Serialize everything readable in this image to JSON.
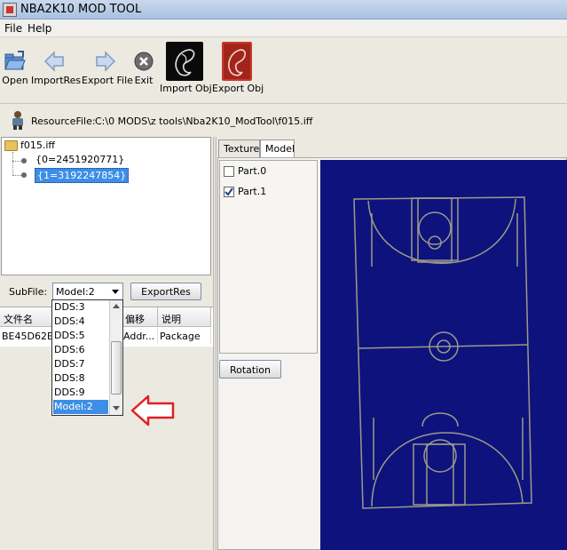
{
  "window": {
    "title": "NBA2K10 MOD TOOL"
  },
  "menu": [
    {
      "label": "File"
    },
    {
      "label": "Help"
    }
  ],
  "toolbar": {
    "open": "Open",
    "import_res": "ImportRes",
    "export_file": "Export File",
    "exit": "Exit",
    "import_obj": "Import Obj",
    "export_obj": "Export Obj"
  },
  "resource": {
    "label": "ResourceFile:",
    "path": "C:\\0 MODS\\z tools\\Nba2K10_ModTool\\f015.iff"
  },
  "tree": {
    "root": "f015.iff",
    "children": [
      "{0=2451920771}",
      "{1=3192247854}"
    ],
    "selected_index": 1
  },
  "subfile": {
    "label": "SubFile:",
    "value": "Model:2",
    "export_button": "ExportRes"
  },
  "table": {
    "headers": [
      "文件名",
      "",
      "偏移",
      "说明"
    ],
    "rows": [
      [
        "BE45D62E",
        "",
        "Addr...",
        "Package"
      ]
    ]
  },
  "dropdown": {
    "items": [
      "DDS:3",
      "DDS:4",
      "DDS:5",
      "DDS:6",
      "DDS:7",
      "DDS:8",
      "DDS:9",
      "Model:2"
    ],
    "selected": "Model:2"
  },
  "tabs": [
    {
      "label": "Texture"
    },
    {
      "label": "Model",
      "active": true
    }
  ],
  "parts": [
    {
      "label": "Part.0",
      "checked": false
    },
    {
      "label": "Part.1",
      "checked": true
    }
  ],
  "rotation_button": "Rotation",
  "colors": {
    "canvas_bg": "#0e127c",
    "court_lines": "#9a9a8a",
    "selection": "#3d8ee6",
    "arrow": "#e02020"
  }
}
